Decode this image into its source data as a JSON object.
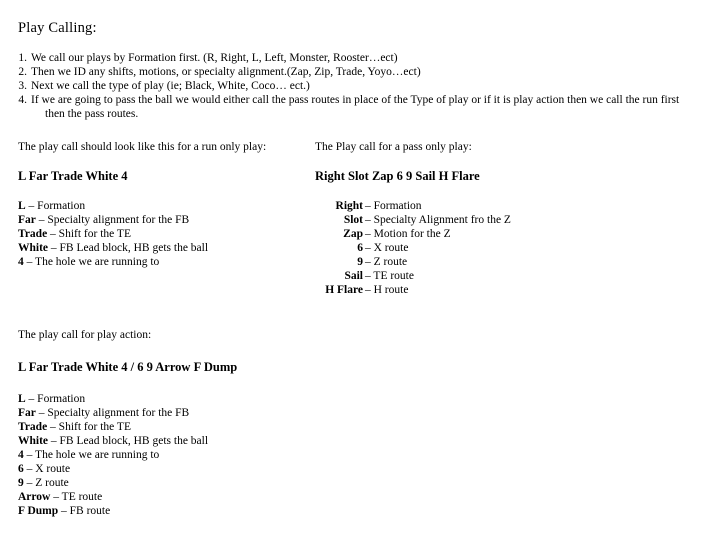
{
  "document": {
    "title": "Play Calling:",
    "intro_list": [
      {
        "number": "1.",
        "text": "We call our plays by Formation first. (R, Right, L, Left, Monster, Rooster…ect)"
      },
      {
        "number": "2.",
        "text": "Then we ID any shifts, motions, or specialty alignment.(Zap,  Zip, Trade, Yoyo…ect)"
      },
      {
        "number": "3.",
        "text": "Next we call the type of play (ie; Black, White, Coco… ect.)"
      },
      {
        "number": "4.",
        "text": "If we are going to pass the ball we would either call the pass routes in place of the Type of play or if it is play action then we call the run first",
        "continuation": "then the pass routes."
      }
    ],
    "run_column": {
      "caption": "The play call should look like this for a run only play:",
      "playcall": "L Far Trade White 4",
      "definitions": [
        {
          "term": "L",
          "desc": "– Formation"
        },
        {
          "term": "Far",
          "desc": "– Specialty alignment for the FB"
        },
        {
          "term": "Trade",
          "desc": "– Shift for the TE"
        },
        {
          "term": "White",
          "desc": "– FB Lead block, HB gets the ball"
        },
        {
          "term": "4",
          "desc": "– The hole we are running to"
        }
      ]
    },
    "pass_column": {
      "caption": "The Play call for a pass only play:",
      "playcall": "Right Slot Zap 6 9 Sail H Flare",
      "definitions": [
        {
          "term": "Right",
          "desc": "– Formation"
        },
        {
          "term": "Slot",
          "desc": "– Specialty Alignment fro the Z"
        },
        {
          "term": "Zap",
          "desc": "– Motion for the Z"
        },
        {
          "term": "6",
          "desc": "– X route"
        },
        {
          "term": "9",
          "desc": "– Z route"
        },
        {
          "term": "Sail",
          "desc": "– TE route"
        },
        {
          "term": "H Flare",
          "desc": "– H route"
        }
      ]
    },
    "play_action": {
      "caption": "The play call for play action:",
      "playcall": "L Far Trade White 4  / 6 9 Arrow F Dump",
      "definitions": [
        {
          "term": "L",
          "desc": "– Formation"
        },
        {
          "term": "Far",
          "desc": "– Specialty alignment for the FB"
        },
        {
          "term": "Trade",
          "desc": "– Shift for the TE"
        },
        {
          "term": "White",
          "desc": "– FB Lead block, HB gets the ball"
        },
        {
          "term": "4",
          "desc": "– The hole we are running to"
        },
        {
          "term": "6",
          "desc": "– X route"
        },
        {
          "term": "9",
          "desc": "– Z route"
        },
        {
          "term": "Arrow",
          "desc": "– TE route"
        },
        {
          "term": "F Dump",
          "desc": "– FB route"
        }
      ]
    }
  }
}
